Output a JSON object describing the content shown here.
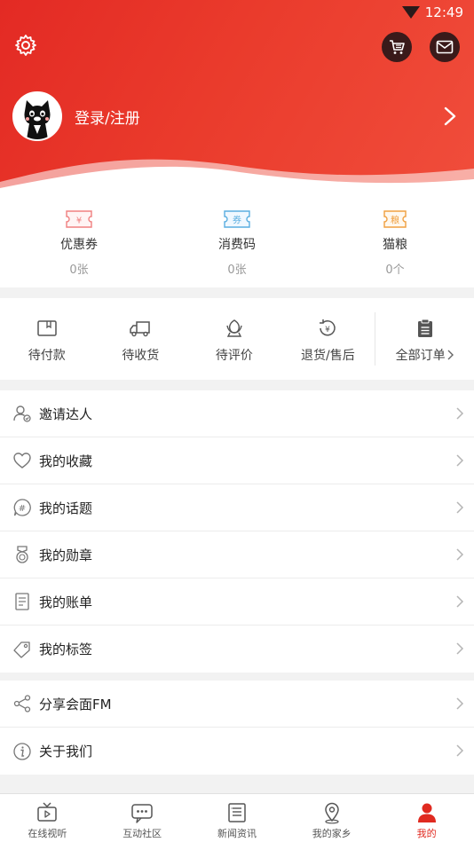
{
  "status_bar": {
    "time": "12:49"
  },
  "colors": {
    "brand_red": "#e32a24",
    "dark_button": "#3a1a1a",
    "coupon_pink": "#f08080",
    "coupon_blue": "#5aaee0",
    "coupon_orange": "#f0a040"
  },
  "header": {
    "login_label": "登录/注册",
    "icons": {
      "settings": "gear-icon",
      "cart": "cart-icon",
      "mail": "mail-icon"
    }
  },
  "coupons": [
    {
      "title": "优惠券",
      "count": "0张",
      "icon_text": "¥",
      "icon": "coupon-icon"
    },
    {
      "title": "消费码",
      "count": "0张",
      "icon_text": "券",
      "icon": "voucher-icon"
    },
    {
      "title": "猫粮",
      "count": "0个",
      "icon_text": "粮",
      "icon": "catfood-icon"
    }
  ],
  "orders": [
    {
      "label": "待付款",
      "icon": "wallet-icon"
    },
    {
      "label": "待收货",
      "icon": "truck-icon"
    },
    {
      "label": "待评价",
      "icon": "review-icon"
    },
    {
      "label": "退货/售后",
      "icon": "refund-icon"
    },
    {
      "label": "全部订单",
      "icon": "clipboard-icon"
    }
  ],
  "menu_primary": [
    {
      "label": "邀请达人",
      "icon": "invite-icon"
    },
    {
      "label": "我的收藏",
      "icon": "heart-icon"
    },
    {
      "label": "我的话题",
      "icon": "hashtag-icon"
    },
    {
      "label": "我的勋章",
      "icon": "medal-icon"
    },
    {
      "label": "我的账单",
      "icon": "bill-icon"
    },
    {
      "label": "我的标签",
      "icon": "tag-icon"
    }
  ],
  "menu_secondary": [
    {
      "label": "分享会面FM",
      "icon": "share-icon"
    },
    {
      "label": "关于我们",
      "icon": "info-icon"
    }
  ],
  "bottom_nav": [
    {
      "label": "在线视听",
      "icon": "tv-icon",
      "active": false
    },
    {
      "label": "互动社区",
      "icon": "chat-icon",
      "active": false
    },
    {
      "label": "新闻资讯",
      "icon": "news-icon",
      "active": false
    },
    {
      "label": "我的家乡",
      "icon": "location-icon",
      "active": false
    },
    {
      "label": "我的",
      "icon": "user-icon",
      "active": true
    }
  ]
}
